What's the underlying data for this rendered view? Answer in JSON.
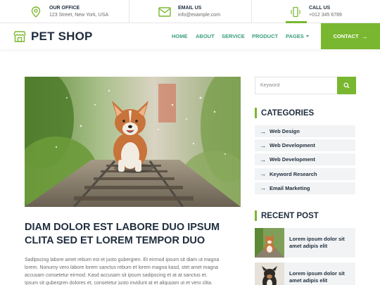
{
  "topbar": {
    "office": {
      "title": "OUR OFFICE",
      "value": "123 Street, New York, USA",
      "icon": "map-marker-icon"
    },
    "email": {
      "title": "EMAIL US",
      "value": "info@example.com",
      "icon": "envelope-icon"
    },
    "call": {
      "title": "CALL US",
      "value": "+012 345 6789",
      "icon": "phone-icon"
    }
  },
  "nav": {
    "brand": "PET SHOP",
    "items": [
      "HOME",
      "ABOUT",
      "SERVICE",
      "PRODUCT",
      "PAGES"
    ],
    "contact": "CONTACT",
    "accent": "#7ab730",
    "link_color": "#3a9f7e"
  },
  "post": {
    "title_lines": [
      "DIAM DOLOR EST LABORE DUO IPSUM",
      "CLITA SED ET LOREM TEMPOR DUO"
    ],
    "body_lines": [
      "Sadipscing labore amet rebum est et justo gubergren. Et eirmod ipsum sit diam ut magna",
      "lorem. Nonumy vero labore lorem sanctus rebum et lorem magna kasd, stet amet magna",
      "accusam consetetur eirmod. Kasd accusam sit ipsum sadipscing et at at sanctus et.",
      "Ipsum sit gubergren dolores et, consetetur justo invidunt at et aliquyam ut et vero clita."
    ]
  },
  "sidebar": {
    "search_placeholder": "Keyword",
    "categories_title": "CATEGORIES",
    "categories": [
      "Web Design",
      "Web Development",
      "Web Development",
      "Keyword Research",
      "Email Marketing"
    ],
    "recent_title": "RECENT POST",
    "recent": [
      {
        "lines": [
          "Lorem ipsum dolor sit",
          "amet adipis elit"
        ]
      },
      {
        "lines": [
          "Lorem ipsum dolor sit",
          "amet adipis elit"
        ]
      }
    ]
  }
}
